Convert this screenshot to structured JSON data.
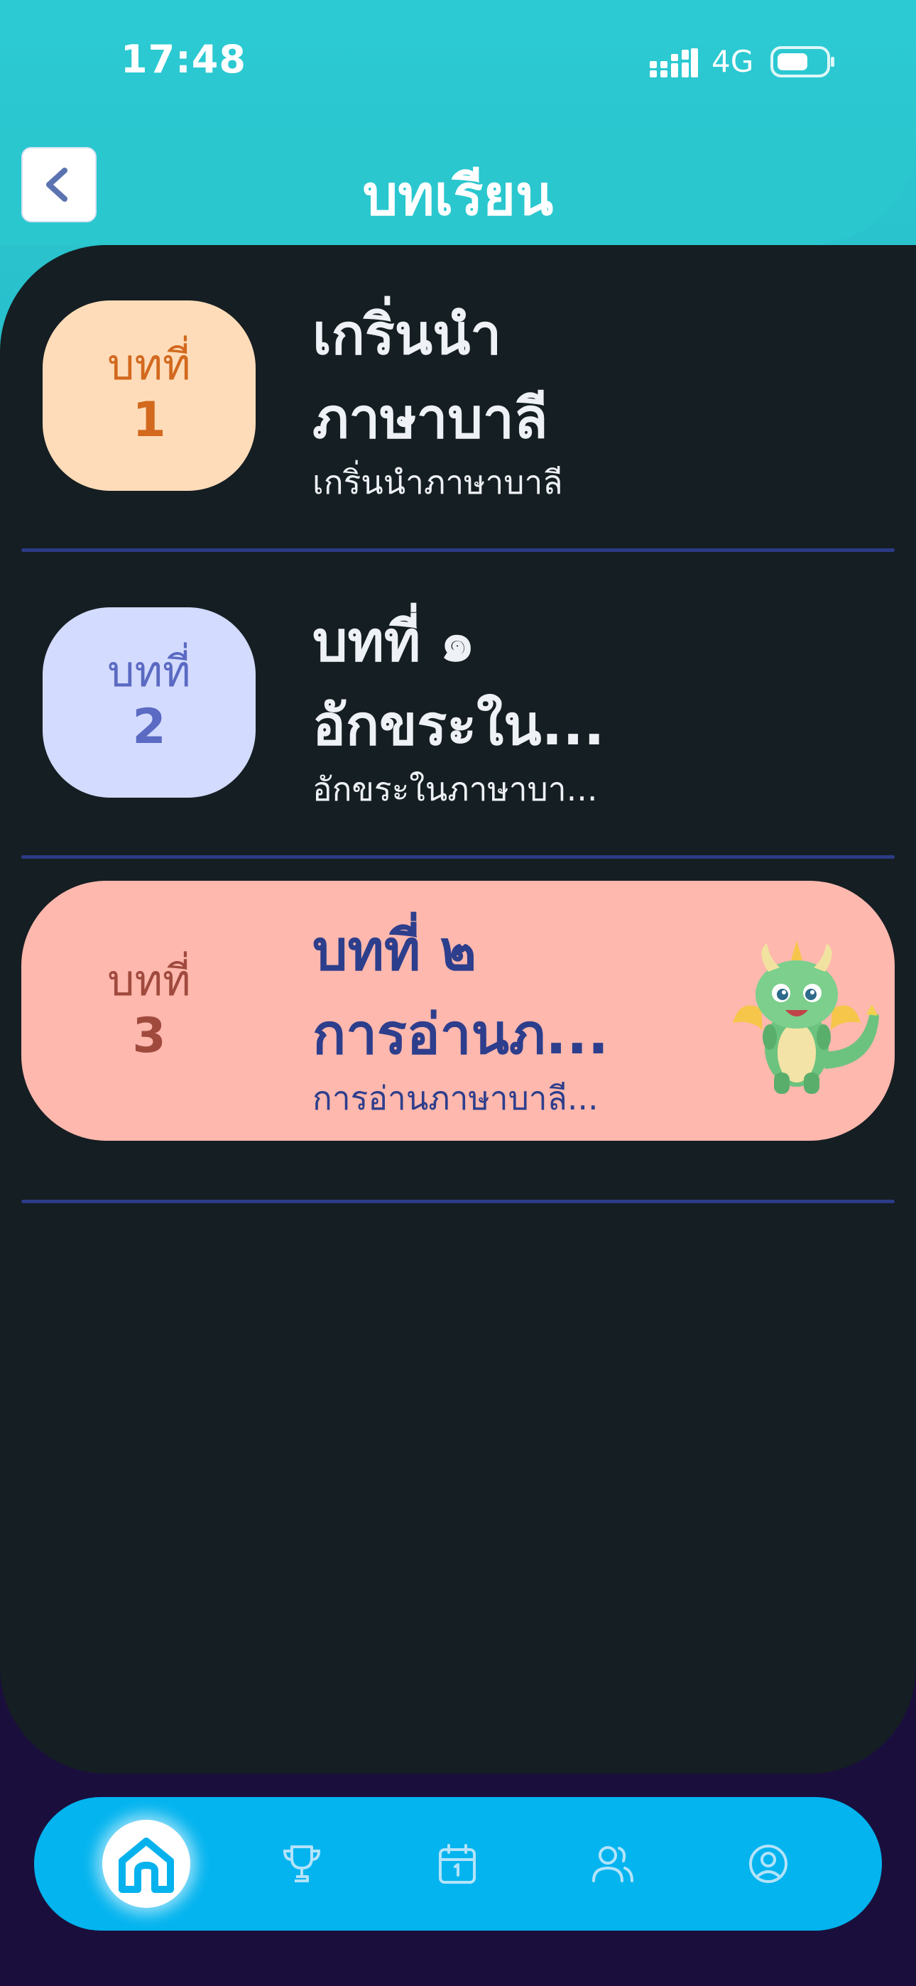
{
  "status": {
    "time": "17:48",
    "network": "4G",
    "signal_icon": "signal-icon",
    "battery_icon": "battery-icon"
  },
  "header": {
    "title": "บทเรียน",
    "back_icon": "chevron-left-icon"
  },
  "lessons": [
    {
      "badge_label": "บทที่",
      "badge_number": "1",
      "title_line1": "เกริ่นนำ",
      "title_line2": "ภาษาบาลี",
      "subtitle": "เกริ่นนำภาษาบาลี",
      "badge_bg": "#ffdcb9",
      "badge_color": "#d2691e"
    },
    {
      "badge_label": "บทที่",
      "badge_number": "2",
      "title_line1": "บทที่ ๑",
      "title_line2": "อักขระใน...",
      "subtitle": "อักขระในภาษาบา...",
      "badge_bg": "#d3dbff",
      "badge_color": "#5b6ac2"
    },
    {
      "badge_label": "บทที่",
      "badge_number": "3",
      "title_line1": "บทที่ ๒",
      "title_line2": "การอ่านภ...",
      "subtitle": "การอ่านภาษาบาลี...",
      "badge_bg": "#ffb8ae",
      "badge_color": "#a04a3e",
      "active": true,
      "mascot": "dragon-mascot-icon"
    }
  ],
  "nav": {
    "items": [
      "home-icon",
      "trophy-icon",
      "calendar-icon",
      "users-icon",
      "profile-icon"
    ],
    "active": "home-icon",
    "bg": "#03b4ef"
  },
  "colors": {
    "accent": "#2ac7cf",
    "panel": "#151e22",
    "divider": "#2c3b86",
    "active_text": "#2d3e8c"
  }
}
